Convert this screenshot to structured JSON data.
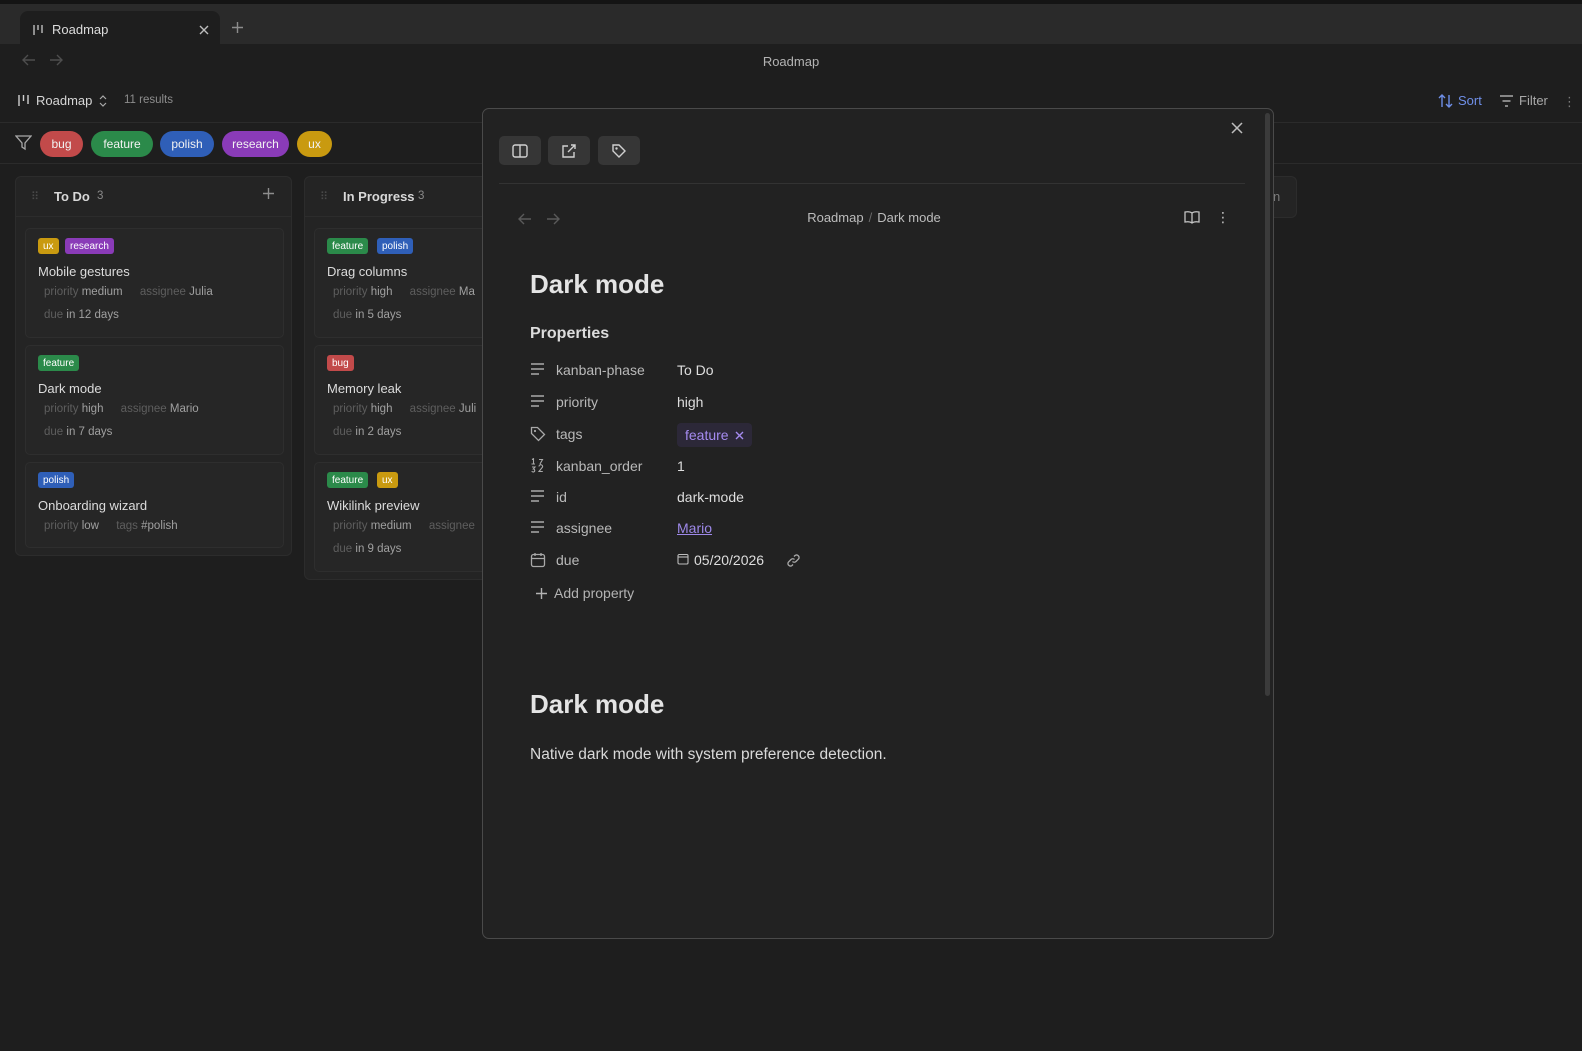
{
  "window": {
    "tab_title": "Roadmap",
    "view_title": "Roadmap"
  },
  "base": {
    "name": "Roadmap",
    "results": "11 results",
    "sort_label": "Sort",
    "filter_label": "Filter",
    "accent_color": "#6f8fe8"
  },
  "filter_tags": [
    {
      "label": "bug",
      "color": "#c24a4a"
    },
    {
      "label": "feature",
      "color": "#2b8a4a"
    },
    {
      "label": "polish",
      "color": "#2f5fb8"
    },
    {
      "label": "research",
      "color": "#8a3bb8"
    },
    {
      "label": "ux",
      "color": "#c99a10"
    }
  ],
  "columns": [
    {
      "title": "To Do",
      "count": "3",
      "cards": [
        {
          "tags": [
            "ux",
            "research"
          ],
          "title": "Mobile gestures",
          "meta1": [
            {
              "k": "priority",
              "v": "medium"
            },
            {
              "k": "assignee",
              "v": "Julia"
            }
          ],
          "meta2": [
            {
              "k": "due",
              "v": "in 12 days"
            }
          ]
        },
        {
          "tags": [
            "feature"
          ],
          "title": "Dark mode",
          "meta1": [
            {
              "k": "priority",
              "v": "high"
            },
            {
              "k": "assignee",
              "v": "Mario"
            }
          ],
          "meta2": [
            {
              "k": "due",
              "v": "in 7 days"
            }
          ]
        },
        {
          "tags": [
            "polish"
          ],
          "title": "Onboarding wizard",
          "meta1": [
            {
              "k": "priority",
              "v": "low"
            },
            {
              "k": "tags",
              "v": "#polish"
            }
          ],
          "meta2": []
        }
      ]
    },
    {
      "title": "In Progress",
      "count": "3",
      "cards": [
        {
          "tags": [
            "feature",
            "polish"
          ],
          "title": "Drag columns",
          "meta1": [
            {
              "k": "priority",
              "v": "high"
            },
            {
              "k": "assignee",
              "v": "Ma"
            }
          ],
          "meta2": [
            {
              "k": "due",
              "v": "in 5 days"
            }
          ]
        },
        {
          "tags": [
            "bug"
          ],
          "title": "Memory leak",
          "meta1": [
            {
              "k": "priority",
              "v": "high"
            },
            {
              "k": "assignee",
              "v": "Juli"
            }
          ],
          "meta2": [
            {
              "k": "due",
              "v": "in 2 days"
            }
          ]
        },
        {
          "tags": [
            "feature",
            "ux"
          ],
          "title": "Wikilink preview",
          "meta1": [
            {
              "k": "priority",
              "v": "medium"
            },
            {
              "k": "assignee",
              "v": ""
            }
          ],
          "meta2": [
            {
              "k": "due",
              "v": "in 9 days"
            }
          ]
        }
      ]
    }
  ],
  "third_column_fragment": "n",
  "modal": {
    "breadcrumb": [
      "Roadmap",
      "Dark mode"
    ],
    "breadcrumb_sep": "/",
    "title": "Dark mode",
    "properties_heading": "Properties",
    "properties": [
      {
        "key": "kanban-phase",
        "value": "To Do",
        "icon": "text-lines-icon"
      },
      {
        "key": "priority",
        "value": "high",
        "icon": "text-lines-icon"
      },
      {
        "key": "tags",
        "value": "feature",
        "icon": "tag-icon"
      },
      {
        "key": "kanban_order",
        "value": "1",
        "icon": "number-icon"
      },
      {
        "key": "id",
        "value": "dark-mode",
        "icon": "text-lines-icon"
      },
      {
        "key": "assignee",
        "value": "Mario",
        "icon": "text-lines-icon"
      },
      {
        "key": "due",
        "value": "05/20/2026",
        "icon": "calendar-icon"
      }
    ],
    "add_property": "Add property",
    "heading": "Dark mode",
    "body": "Native dark mode with system preference detection."
  }
}
